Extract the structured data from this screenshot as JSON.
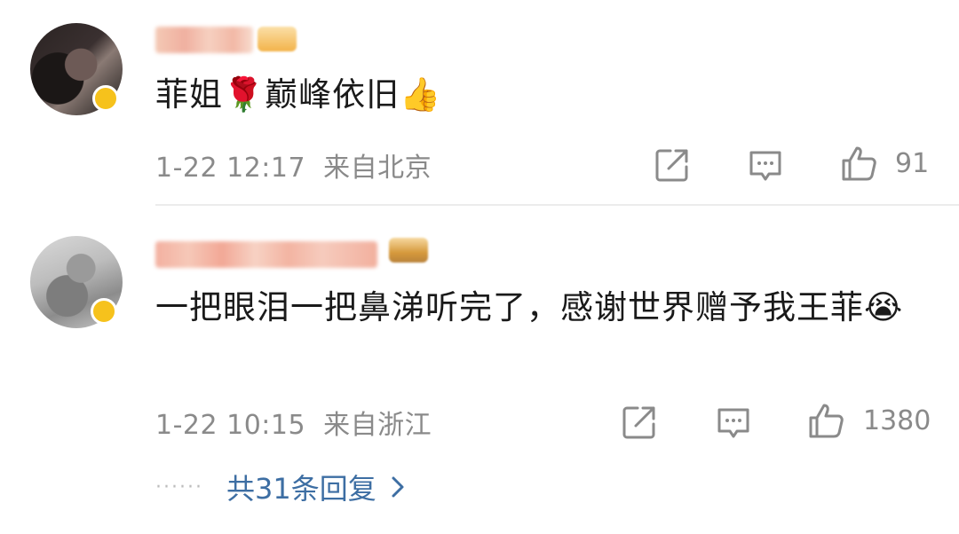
{
  "comments": [
    {
      "username": "",
      "content": "菲姐🌹巅峰依旧👍",
      "time": "1-22 12:17",
      "location": "来自北京",
      "likes": "91"
    },
    {
      "username": "",
      "content": "一把眼泪一把鼻涕听完了，感谢世界赠予我王菲😭",
      "time": "1-22 10:15",
      "location": "来自浙江",
      "likes": "1380"
    }
  ],
  "replies": {
    "dots": "······",
    "label": "共31条回复"
  },
  "icons": {
    "share": "share-icon",
    "comment": "comment-icon",
    "like": "thumbs-up-icon",
    "chevron": "chevron-right-icon"
  },
  "colors": {
    "text": "#1a1a1a",
    "meta": "#8a8a8a",
    "link": "#3d6ea3",
    "badge": "#f6c21c"
  }
}
